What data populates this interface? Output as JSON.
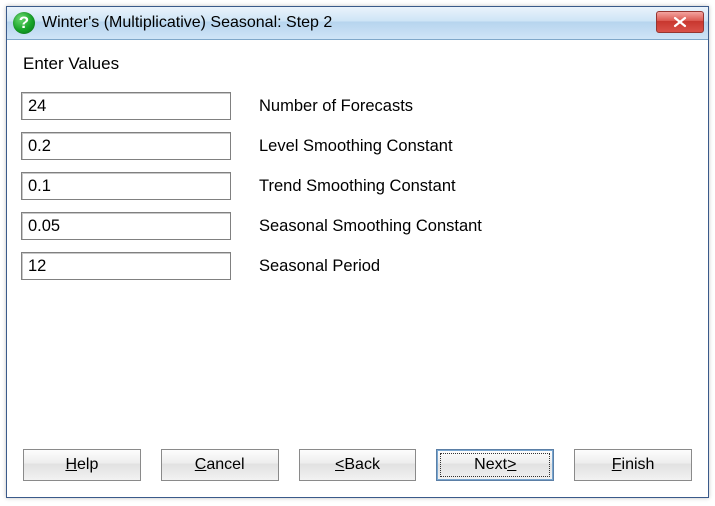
{
  "window": {
    "title": "Winter's (Multiplicative) Seasonal: Step 2"
  },
  "heading": "Enter Values",
  "fields": {
    "num_forecasts": {
      "value": "24",
      "label": "Number of Forecasts"
    },
    "level": {
      "value": "0.2",
      "label": "Level Smoothing Constant"
    },
    "trend": {
      "value": "0.1",
      "label": "Trend Smoothing Constant"
    },
    "seasonal": {
      "value": "0.05",
      "label": "Seasonal Smoothing Constant"
    },
    "period": {
      "value": "12",
      "label": "Seasonal Period"
    }
  },
  "buttons": {
    "help": {
      "pre": "",
      "mn": "H",
      "post": "elp"
    },
    "cancel": {
      "pre": "",
      "mn": "C",
      "post": "ancel"
    },
    "back": {
      "pre": "",
      "mn": "<",
      "post": " Back"
    },
    "next": {
      "pre": "Next ",
      "mn": ">",
      "post": ""
    },
    "finish": {
      "pre": "",
      "mn": "F",
      "post": "inish"
    }
  }
}
